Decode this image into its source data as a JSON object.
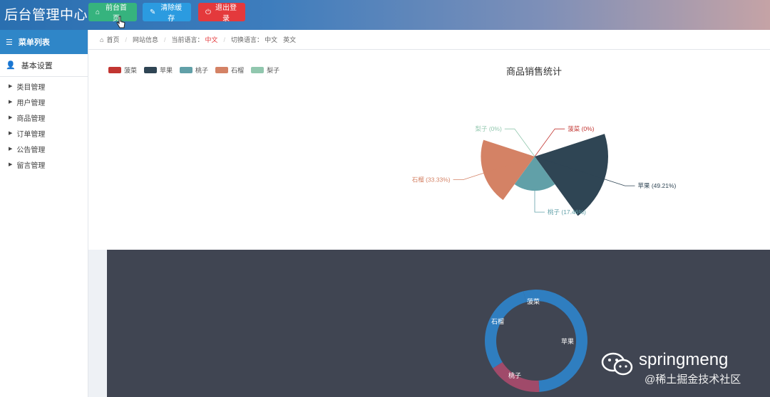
{
  "app": {
    "title": "后台管理中心"
  },
  "topbar": {
    "home_label": "前台首页",
    "clear_label": "清除缓存",
    "logout_label": "退出登录"
  },
  "sidebar": {
    "header": "菜单列表",
    "group": "基本设置",
    "items": [
      {
        "label": "类目管理"
      },
      {
        "label": "用户管理"
      },
      {
        "label": "商品管理"
      },
      {
        "label": "订单管理"
      },
      {
        "label": "公告管理"
      },
      {
        "label": "留言管理"
      }
    ]
  },
  "breadcrumb": {
    "home": "首页",
    "site_info": "网站信息",
    "current_lang_label": "当前语言：",
    "current_lang": "中文",
    "switch_lang_label": "切换语言：",
    "lang_cn": "中文",
    "lang_en": "英文"
  },
  "chart_data": [
    {
      "type": "pie",
      "title": "商品销售统计",
      "legend_position": "top-left",
      "series": [
        {
          "name": "菠菜",
          "value_pct": 0,
          "color": "#c23531",
          "label": "菠菜 (0%)"
        },
        {
          "name": "苹果",
          "value_pct": 49.21,
          "color": "#2f4554",
          "label": "苹果 (49.21%)"
        },
        {
          "name": "桃子",
          "value_pct": 17.46,
          "color": "#61a0a8",
          "label": "桃子 (17.46%)"
        },
        {
          "name": "石榴",
          "value_pct": 33.33,
          "color": "#d48265",
          "label": "石榴 (33.33%)"
        },
        {
          "name": "梨子",
          "value_pct": 0,
          "color": "#91c7ae",
          "label": "梨子 (0%)"
        }
      ]
    },
    {
      "type": "pie",
      "style": "donut",
      "labels": [
        "菠菜",
        "苹果",
        "桃子",
        "石榴"
      ]
    }
  ],
  "watermark": {
    "name": "springmeng",
    "sub": "@稀土掘金技术社区"
  }
}
